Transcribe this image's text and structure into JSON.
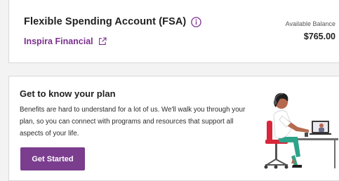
{
  "fsa": {
    "title": "Flexible Spending Account (FSA)",
    "provider": "Inspira Financial",
    "balance_label": "Available Balance",
    "balance_value": "$765.00",
    "icons": {
      "info": "info-circle-icon",
      "external_link": "external-link-icon"
    }
  },
  "plan": {
    "title": "Get to know your plan",
    "description": "Benefits are hard to understand for a lot of us. We'll walk you through your plan, so you can connect with programs and resources that support all aspects of your life.",
    "cta_label": "Get Started",
    "illustration": "woman-at-desk-video-call-illustration"
  },
  "colors": {
    "accent": "#7b3d8e",
    "link": "#7b2f8e",
    "background": "#f3f3f3",
    "card": "#ffffff"
  }
}
